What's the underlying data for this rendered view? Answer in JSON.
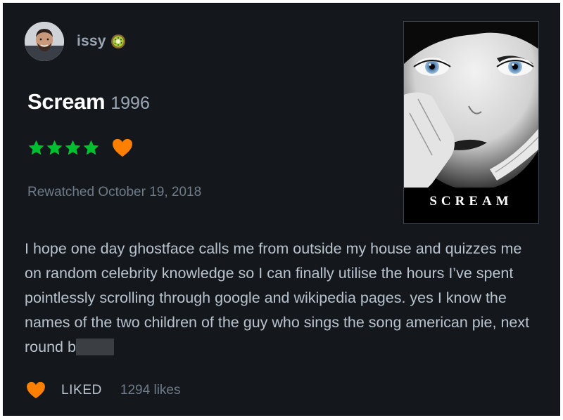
{
  "review": {
    "username": "issy",
    "film_title": "Scream",
    "film_year": "1996",
    "rating_stars": 4,
    "liked_heart": true,
    "watched_text": "Rewatched October 19, 2018",
    "poster_title": "SCREAM",
    "body_text": "I hope one day ghostface calls me from outside my house and quizzes me on random celebrity knowledge so I can finally utilise the hours I’ve spent pointlessly scrolling through google and wikipedia pages. yes I know the names of the two children of the guy who sings the song american pie, next round b",
    "liked_label": "LIKED",
    "likes_count": "1294 likes"
  },
  "colors": {
    "background": "#14181c",
    "star": "#00c030",
    "heart": "#ff8000",
    "muted_text": "#6f7b88",
    "body_text": "#b9c3cd"
  },
  "icons": {
    "badge": "kiwi-icon",
    "star": "star-icon",
    "heart": "heart-icon"
  }
}
